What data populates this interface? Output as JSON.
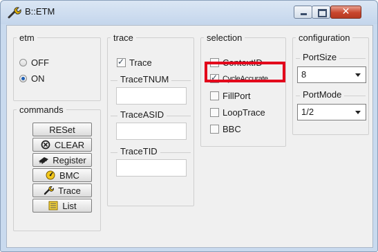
{
  "window": {
    "title": "B::ETM",
    "close_glyph": "✕"
  },
  "etm": {
    "legend": "etm",
    "options": [
      {
        "label": "OFF",
        "selected": false
      },
      {
        "label": "ON",
        "selected": true
      }
    ]
  },
  "commands": {
    "legend": "commands",
    "buttons": [
      {
        "label": "RESet",
        "icon": "none"
      },
      {
        "label": "CLEAR",
        "icon": "clear-circle-icon"
      },
      {
        "label": "Register",
        "icon": "chip-icon"
      },
      {
        "label": "BMC",
        "icon": "gauge-icon"
      },
      {
        "label": "Trace",
        "icon": "wrench-icon"
      },
      {
        "label": "List",
        "icon": "list-icon"
      }
    ]
  },
  "trace": {
    "legend": "trace",
    "trace_checkbox": {
      "label": "Trace",
      "checked": true
    },
    "tracetnum": {
      "label": "TraceTNUM",
      "value": ""
    },
    "traceasid": {
      "label": "TraceASID",
      "value": ""
    },
    "tracetid": {
      "label": "TraceTID",
      "value": ""
    }
  },
  "selection": {
    "legend": "selection",
    "items": [
      {
        "label": "ContextID",
        "checked": false
      },
      {
        "label": "CycleAccurate",
        "checked": true,
        "highlighted": true
      },
      {
        "label": "FillPort",
        "checked": false
      },
      {
        "label": "LoopTrace",
        "checked": false
      },
      {
        "label": "BBC",
        "checked": false
      }
    ]
  },
  "configuration": {
    "legend": "configuration",
    "portsize": {
      "label": "PortSize",
      "value": "8"
    },
    "portmode": {
      "label": "PortMode",
      "value": "1/2"
    }
  },
  "colors": {
    "highlight": "#e3001b",
    "radio_selected": "#1e5fb4",
    "close_button": "#c8452c"
  }
}
